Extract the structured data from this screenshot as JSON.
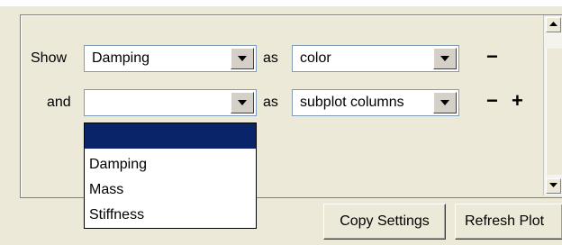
{
  "row1": {
    "prefix": "Show",
    "field": "Damping",
    "as_label": "as",
    "mapping": "color",
    "remove": "−"
  },
  "row2": {
    "prefix": "and",
    "field": "",
    "as_label": "as",
    "mapping": "subplot columns",
    "remove": "−",
    "add": "+"
  },
  "dropdown": {
    "options": [
      "",
      "Damping",
      "Mass",
      "Stiffness"
    ],
    "selected_index": 0
  },
  "buttons": {
    "copy_settings": "Copy Settings",
    "refresh_plot": "Refresh Plot"
  },
  "colors": {
    "background": "#ece9d8",
    "selection": "#0a246a",
    "field_border": "#7f9db9"
  },
  "icons": {
    "combo_arrow": "triangle-down",
    "scroll_up": "triangle-up",
    "scroll_down": "triangle-down"
  }
}
